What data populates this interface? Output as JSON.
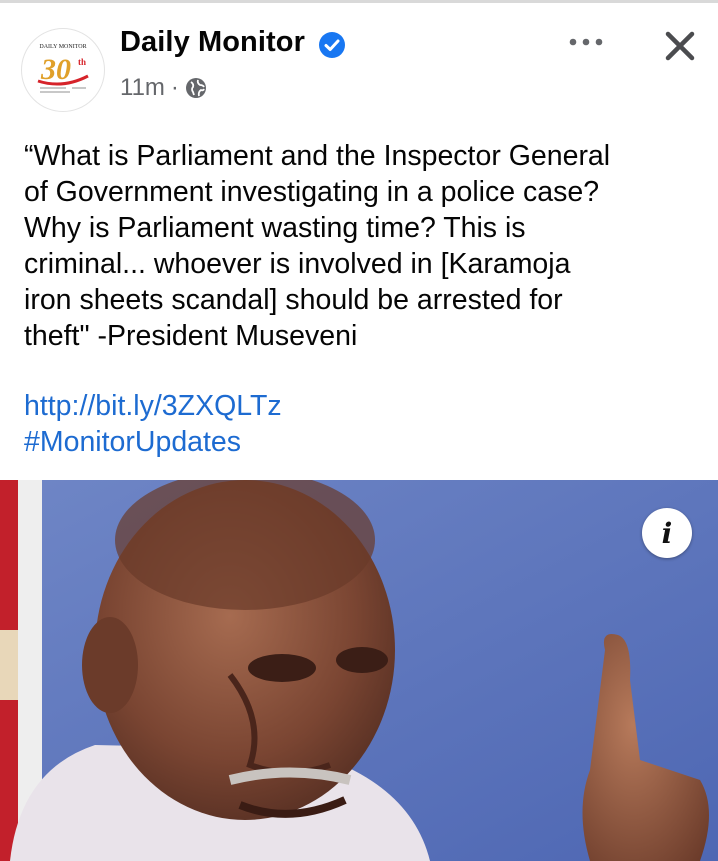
{
  "post": {
    "page_name": "Daily Monitor",
    "time": "11m",
    "separator": "·",
    "text_lines": [
      "“What is Parliament and the Inspector General",
      "of Government investigating in a police case?",
      "Why is Parliament wasting time? This is",
      "criminal... whoever is involved in [Karamoja",
      "iron sheets scandal] should be arrested for",
      "theft\" -President Museveni"
    ],
    "link": "http://bit.ly/3ZXQLTz",
    "hashtag": "#MonitorUpdates",
    "info_icon_label": "i"
  },
  "logo": {
    "masthead": "DAILY MONITOR",
    "number": "30",
    "suffix": "th"
  },
  "colors": {
    "link": "#1d6bd1",
    "verified": "#1877f2",
    "meta": "#65676b",
    "logo_red": "#d6232a",
    "logo_gold": "#e0a02a"
  },
  "icons": [
    "verified-badge-icon",
    "globe-icon",
    "more-options-icon",
    "close-icon",
    "info-icon"
  ]
}
